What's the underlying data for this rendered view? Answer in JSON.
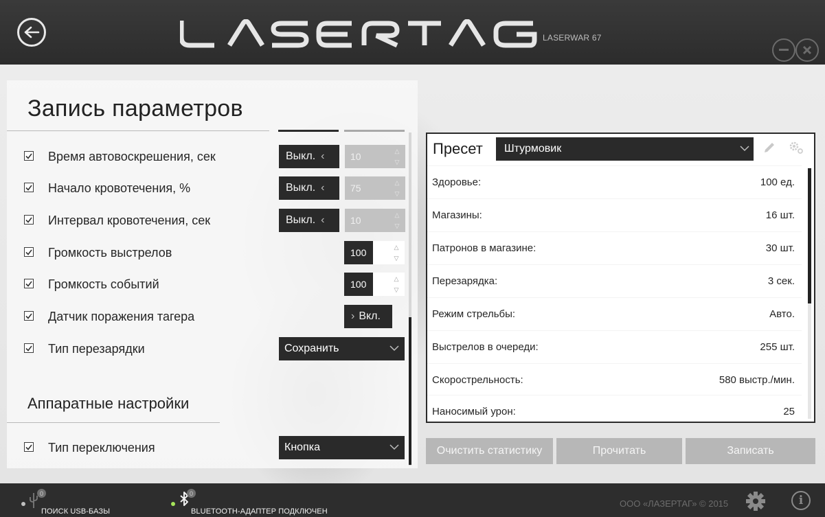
{
  "header": {
    "logo_text": "LASERTAG",
    "device_name": "LASERWAR 67"
  },
  "left_panel": {
    "title": "Запись параметров",
    "rows": [
      {
        "label": "Время автовоскрешения, сек",
        "checked": true,
        "toggle": "Выкл.",
        "value": "10"
      },
      {
        "label": "Начало кровотечения, %",
        "checked": true,
        "toggle": "Выкл.",
        "value": "75"
      },
      {
        "label": "Интервал кровотечения, сек",
        "checked": true,
        "toggle": "Выкл.",
        "value": "10"
      },
      {
        "label": "Громкость выстрелов",
        "checked": true,
        "value": "100"
      },
      {
        "label": "Громкость событий",
        "checked": true,
        "value": "100"
      },
      {
        "label": "Датчик поражения тагера",
        "checked": true,
        "toggle": "Вкл."
      },
      {
        "label": "Тип перезарядки",
        "checked": true,
        "select": "Сохранить"
      }
    ],
    "hardware_section": {
      "title": "Аппаратные настройки",
      "rows": [
        {
          "label": "Тип переключения",
          "checked": true,
          "select": "Кнопка"
        }
      ]
    }
  },
  "preset": {
    "label": "Пресет",
    "selected": "Штурмовик",
    "stats": [
      {
        "label": "Здоровье:",
        "value": "100 ед."
      },
      {
        "label": "Магазины:",
        "value": "16 шт."
      },
      {
        "label": "Патронов в магазине:",
        "value": "30 шт."
      },
      {
        "label": "Перезарядка:",
        "value": "3 сек."
      },
      {
        "label": "Режим стрельбы:",
        "value": "Авто."
      },
      {
        "label": "Выстрелов в очереди:",
        "value": "255 шт."
      },
      {
        "label": "Скорострельность:",
        "value": "580 выстр./мин."
      },
      {
        "label": "Наносимый урон:",
        "value": "25"
      }
    ]
  },
  "actions": {
    "clear_label": "Очистить статистику",
    "read_label": "Прочитать",
    "write_label": "Записать"
  },
  "statusbar": {
    "usb_count": "0",
    "usb_text": "ПОИСК USB-БАЗЫ",
    "bt_count": "0",
    "bt_text": "BLUETOOTH-АДАПТЕР ПОДКЛЮЧЕН",
    "copyright": "ООО «ЛАЗЕРТАГ» © 2015"
  },
  "colors": {
    "dark": "#2a2a2a",
    "disabled": "#b7b7b7",
    "bt_status": "#a6e65a"
  }
}
